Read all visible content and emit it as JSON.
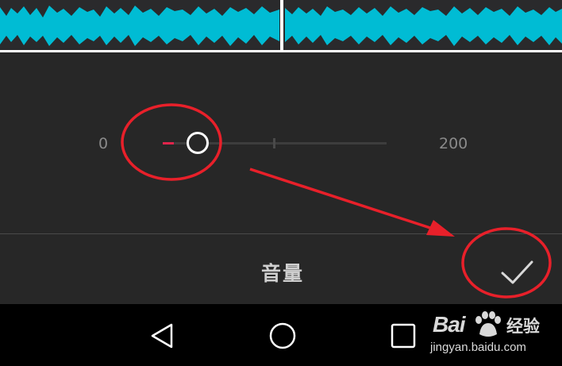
{
  "volume_slider": {
    "min_label": "0",
    "max_label": "200",
    "value": 10,
    "min": 0,
    "max": 200
  },
  "panel": {
    "title": "音量",
    "confirm_icon": "checkmark-icon"
  },
  "nav_bar": {
    "back_icon": "back-triangle-icon",
    "home_icon": "home-circle-icon",
    "recent_icon": "recent-apps-square-icon"
  },
  "watermark": {
    "brand": "Bai",
    "cn": "经验",
    "url": "jingyan.baidu.com"
  },
  "colors": {
    "waveform": "#00bcd4",
    "slider_fill": "#e0244b",
    "annotation": "#e8202a",
    "panel_bg": "#272727"
  }
}
